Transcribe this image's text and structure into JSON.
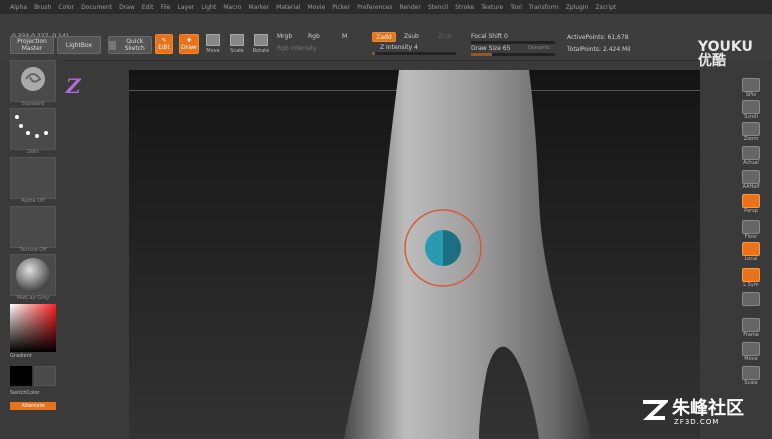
{
  "menubar": [
    "Alpha",
    "Brush",
    "Color",
    "Document",
    "Draw",
    "Edit",
    "File",
    "Layer",
    "Light",
    "Macro",
    "Marker",
    "Material",
    "Movie",
    "Picker",
    "Preferences",
    "Render",
    "Stencil",
    "Stroke",
    "Texture",
    "Tool",
    "Transform",
    "Zplugin",
    "Zscript"
  ],
  "toolbar": {
    "coords": "0.334,0.227,-0.141",
    "projection_master": "Projection Master",
    "lightbox": "LightBox",
    "quick_sketch": "Quick Sketch",
    "edit": "Edit",
    "draw": "Draw",
    "move": "Move",
    "scale": "Scale",
    "rotate": "Rotate",
    "mrgb": "Mrgb",
    "rgb": "Rgb",
    "m": "M",
    "rgb_intensity": "Rgb Intensity",
    "zadd": "Zadd",
    "zsub": "Zsub",
    "zcut": "Zcut",
    "z_intensity": "Z Intensity 4",
    "focal_shift": "Focal Shift 0",
    "draw_size": "Draw Size 65",
    "dynamic": "Dynamic",
    "active_points": "ActivePoints: 61,678",
    "total_points": "TotalPoints: 2.424 Mil",
    "z_intensity_level": 0.04,
    "draw_size_level": 0.25
  },
  "left": {
    "thumbs": [
      "Standard",
      "Dots",
      "Alpha Off",
      "Texture Off",
      "MatCap Gray"
    ],
    "gradient": "Gradient",
    "switch_color": "SwitchColor",
    "alternate": "Alternate"
  },
  "right": {
    "buttons": [
      "SPix",
      "Scroll",
      "Zoom",
      "Actual",
      "AAHalf",
      "Persp",
      "Floor",
      "Local",
      "L.Sym",
      "",
      "Frame",
      "Move",
      "Scale"
    ]
  },
  "overlays": {
    "youku_1": "YOUKU",
    "youku_2": "优酷",
    "watermark_zh": "朱峰社区",
    "watermark_en": "ZF3D.COM"
  },
  "colors": {
    "accent_orange": "#e8731a",
    "panel": "#3a3a3a",
    "brush_ring": "#d9553a",
    "brush_core": "#2a9ab0"
  }
}
